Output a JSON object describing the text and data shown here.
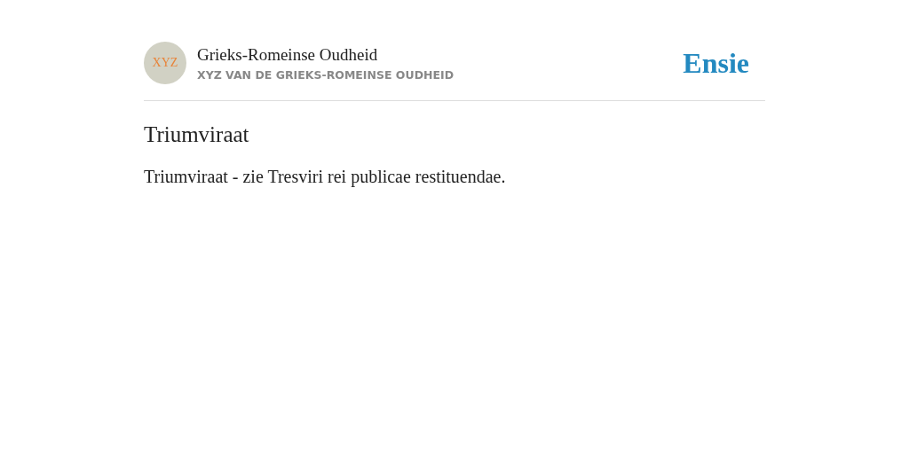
{
  "header": {
    "avatar_text": "XYZ",
    "title": "Grieks-Romeinse Oudheid",
    "subtitle": "XYZ VAN DE GRIEKS-ROMEINSE OUDHEID",
    "logo": "Ensie"
  },
  "article": {
    "heading": "Triumviraat",
    "body": "Triumviraat - zie Tresviri rei publicae restituendae."
  }
}
